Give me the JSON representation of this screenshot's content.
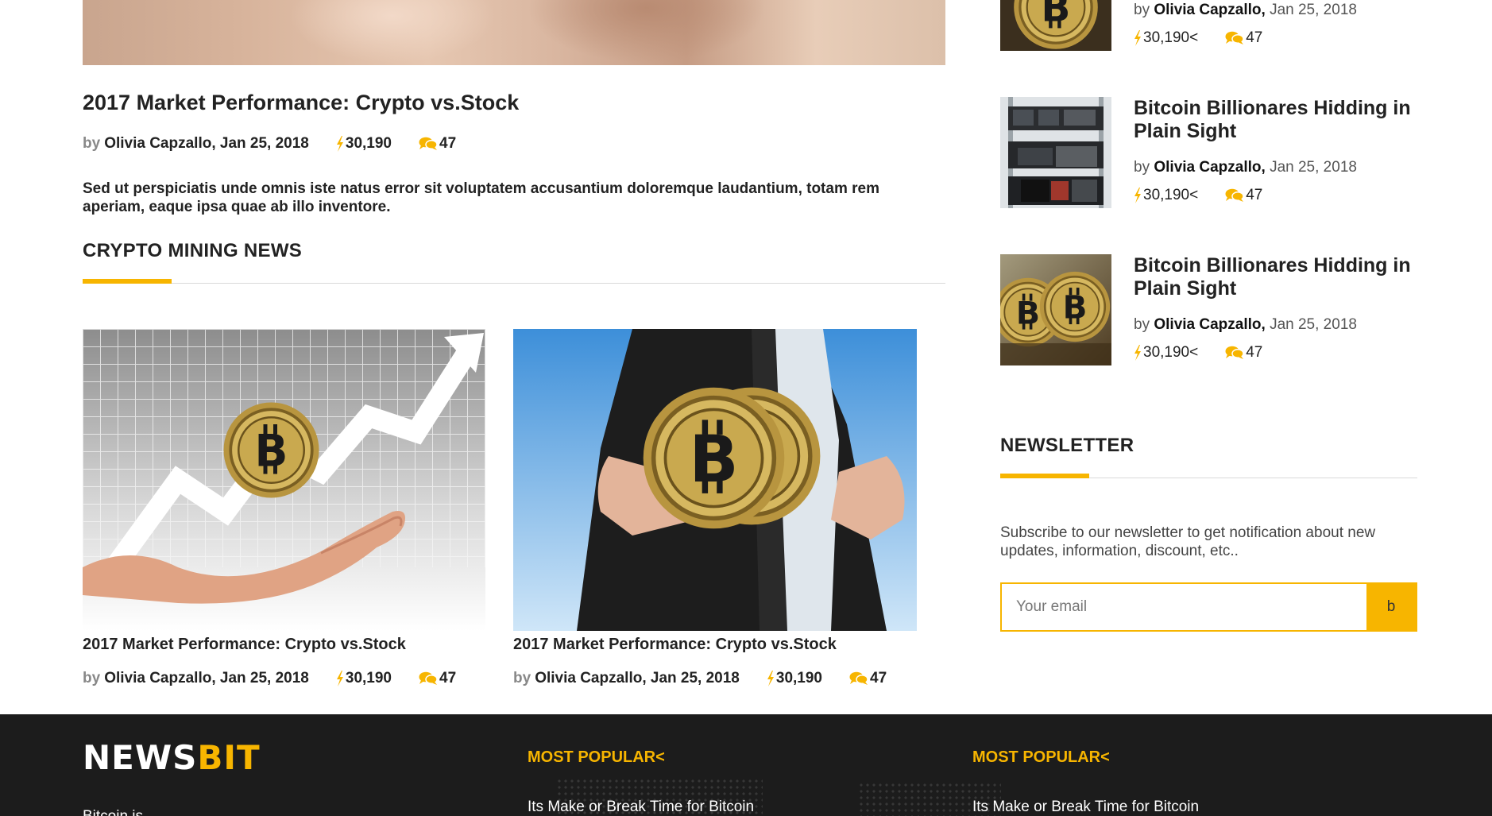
{
  "featured": {
    "title": "2017 Market Performance: Crypto vs.Stock",
    "by": "by",
    "author_date": "Olivia Capzallo, Jan 25, 2018",
    "views": "30,190",
    "comments": "47",
    "excerpt": "Sed ut perspiciatis unde omnis iste natus error sit voluptatem accusantium doloremque laudantium, totam rem aperiam, eaque ipsa quae ab illo inventore."
  },
  "mining_section": {
    "title": "CRYPTO MINING NEWS",
    "cards": [
      {
        "title": "2017 Market Performance: Crypto vs.Stock",
        "by": "by",
        "author_date": "Olivia Capzallo, Jan 25, 2018",
        "views": "30,190",
        "comments": "47"
      },
      {
        "title": "2017 Market Performance: Crypto vs.Stock",
        "by": "by",
        "author_date": "Olivia Capzallo, Jan 25, 2018",
        "views": "30,190",
        "comments": "47"
      }
    ]
  },
  "sidebar": {
    "posts": [
      {
        "title": "",
        "by": "by",
        "author": "Olivia Capzallo,",
        "date": "Jan 25, 2018",
        "views": "30,190<",
        "comments": "47"
      },
      {
        "title": "Bitcoin Billionares Hidding in Plain Sight",
        "by": "by",
        "author": "Olivia Capzallo,",
        "date": "Jan 25, 2018",
        "views": "30,190<",
        "comments": "47"
      },
      {
        "title": "Bitcoin Billionares Hidding in Plain Sight",
        "by": "by",
        "author": "Olivia Capzallo,",
        "date": "Jan 25, 2018",
        "views": "30,190<",
        "comments": "47"
      }
    ],
    "newsletter": {
      "title": "NEWSLETTER",
      "text": "Subscribe to our newsletter to get notification about new updates, information, discount, etc..",
      "placeholder": "Your email",
      "button": "b"
    }
  },
  "footer": {
    "logo_news": "NEWS",
    "logo_bit": "BIT",
    "col1_title": "MOST POPULAR<",
    "col1_link": "Its Make or Break Time for Bitcoin",
    "col2_title": "MOST POPULAR<",
    "col2_link": "Its Make or Break Time for Bitcoin",
    "desc": "Bitcoin is"
  },
  "colors": {
    "accent": "#f7b500",
    "footer_bg": "#1c1c1c"
  },
  "icons": {
    "views": "lightning-bolt-icon",
    "comments": "chat-bubbles-icon"
  }
}
